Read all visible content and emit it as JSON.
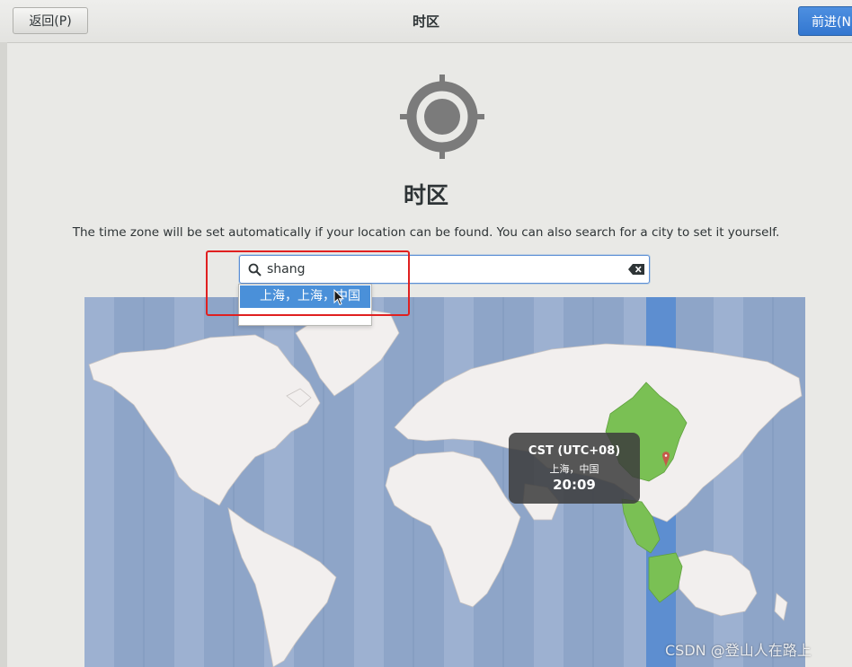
{
  "header": {
    "back_label": "返回(P)",
    "title": "时区",
    "next_label": "前进(N"
  },
  "page": {
    "title": "时区",
    "description": "The time zone will be set automatically if your location can be found. You can also search for a city to set it yourself."
  },
  "search": {
    "value": "shang",
    "results": [
      "上海，上海，中国"
    ]
  },
  "tooltip": {
    "abbr": "CST (UTC+08)",
    "city": "上海，中国",
    "time": "20:09"
  },
  "watermark": "CSDN @登山人在路上",
  "colors": {
    "ocean": "#8ea5c8",
    "land": "#f2efee",
    "selected_zone": "#5d8ed0",
    "selected_land": "#7ac054",
    "accent": "#4a90d9",
    "annotation": "#e02020"
  }
}
